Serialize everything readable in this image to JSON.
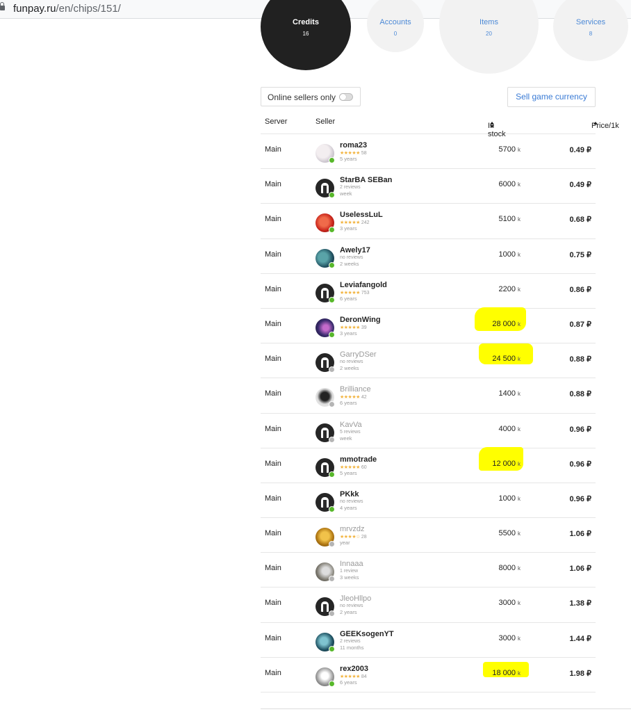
{
  "browser": {
    "url_host": "funpay.ru",
    "url_path": "/en/chips/151/"
  },
  "categories": [
    {
      "title": "Credits",
      "count": "16",
      "active": true
    },
    {
      "title": "Accounts",
      "count": "0",
      "active": false
    },
    {
      "title": "Items",
      "count": "20",
      "active": false
    },
    {
      "title": "Services",
      "count": "8",
      "active": false
    }
  ],
  "filters": {
    "online_label": "Online sellers only",
    "online_enabled": false,
    "sell_label": "Sell game currency"
  },
  "table": {
    "headers": {
      "server": "Server",
      "seller": "Seller",
      "stock": "In stock",
      "price": "Price/1k"
    },
    "stock_unit": "k",
    "rows": [
      {
        "server": "Main",
        "seller": "roma23",
        "stars": "★★★★★",
        "reviews": "58",
        "age": "5 years",
        "stock": "5700",
        "price": "0.49 ₽",
        "online": true,
        "avatar": "anime",
        "highlight": false
      },
      {
        "server": "Main",
        "seller": "StarBA SEBan",
        "stars": "",
        "reviews": "2 reviews",
        "age": "week",
        "stock": "6000",
        "price": "0.49 ₽",
        "online": true,
        "avatar": "default",
        "highlight": false
      },
      {
        "server": "Main",
        "seller": "UselessLuL",
        "stars": "★★★★★",
        "reviews": "242",
        "age": "3 years",
        "stock": "5100",
        "price": "0.68 ₽",
        "online": true,
        "avatar": "red",
        "highlight": false
      },
      {
        "server": "Main",
        "seller": "Awely17",
        "stars": "",
        "reviews": "no reviews",
        "age": "2 weeks",
        "stock": "1000",
        "price": "0.75 ₽",
        "online": true,
        "avatar": "teal",
        "highlight": false
      },
      {
        "server": "Main",
        "seller": "Leviafangold",
        "stars": "★★★★★",
        "reviews": "753",
        "age": "6 years",
        "stock": "2200",
        "price": "0.86 ₽",
        "online": true,
        "avatar": "default",
        "highlight": false
      },
      {
        "server": "Main",
        "seller": "DeronWing",
        "stars": "★★★★★",
        "reviews": "39",
        "age": "3 years",
        "stock": "28 000",
        "price": "0.87 ₽",
        "online": true,
        "avatar": "purple",
        "highlight": true
      },
      {
        "server": "Main",
        "seller": "GarryDSer",
        "stars": "",
        "reviews": "no reviews",
        "age": "2 weeks",
        "stock": "24 500",
        "price": "0.88 ₽",
        "online": false,
        "avatar": "default",
        "highlight": true
      },
      {
        "server": "Main",
        "seller": "Brilliance",
        "stars": "★★★★★",
        "reviews": "42",
        "age": "6 years",
        "stock": "1400",
        "price": "0.88 ₽",
        "online": false,
        "avatar": "bw",
        "highlight": false
      },
      {
        "server": "Main",
        "seller": "KavVa",
        "stars": "",
        "reviews": "5 reviews",
        "age": "week",
        "stock": "4000",
        "price": "0.96 ₽",
        "online": false,
        "avatar": "default",
        "highlight": false
      },
      {
        "server": "Main",
        "seller": "mmotrade",
        "stars": "★★★★★",
        "reviews": "60",
        "age": "5 years",
        "stock": "12 000",
        "price": "0.96 ₽",
        "online": true,
        "avatar": "default",
        "highlight": true
      },
      {
        "server": "Main",
        "seller": "PKkk",
        "stars": "",
        "reviews": "no reviews",
        "age": "4 years",
        "stock": "1000",
        "price": "0.96 ₽",
        "online": true,
        "avatar": "default",
        "highlight": false
      },
      {
        "server": "Main",
        "seller": "mrvzdz",
        "stars": "★★★★☆",
        "reviews": "28",
        "age": "year",
        "stock": "5500",
        "price": "1.06 ₽",
        "online": false,
        "avatar": "gold",
        "highlight": false
      },
      {
        "server": "Main",
        "seller": "Innaaa",
        "stars": "",
        "reviews": "1 review",
        "age": "3 weeks",
        "stock": "8000",
        "price": "1.06 ₽",
        "online": false,
        "avatar": "photo",
        "highlight": false
      },
      {
        "server": "Main",
        "seller": "JleoHllpo",
        "stars": "",
        "reviews": "no reviews",
        "age": "2 years",
        "stock": "3000",
        "price": "1.38 ₽",
        "online": false,
        "avatar": "default",
        "highlight": false
      },
      {
        "server": "Main",
        "seller": "GEEKsogenYT",
        "stars": "",
        "reviews": "2 reviews",
        "age": "11 months",
        "stock": "3000",
        "price": "1.44 ₽",
        "online": true,
        "avatar": "teal2",
        "highlight": false
      },
      {
        "server": "Main",
        "seller": "rex2003",
        "stars": "★★★★★",
        "reviews": "84",
        "age": "6 years",
        "stock": "18 000",
        "price": "1.98 ₽",
        "online": true,
        "avatar": "grey",
        "highlight": true
      }
    ]
  }
}
